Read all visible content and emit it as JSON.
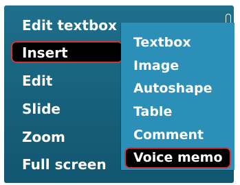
{
  "main_menu": {
    "items": [
      {
        "label": "Edit textbox"
      },
      {
        "label": "Insert"
      },
      {
        "label": "Edit"
      },
      {
        "label": "Slide"
      },
      {
        "label": "Zoom"
      },
      {
        "label": "Full screen"
      }
    ],
    "selected_item": "Insert"
  },
  "submenu": {
    "items": [
      {
        "label": "Textbox"
      },
      {
        "label": "Image"
      },
      {
        "label": "Autoshape"
      },
      {
        "label": "Table"
      },
      {
        "label": "Comment"
      },
      {
        "label": "Voice memo"
      }
    ],
    "selected_item": "Voice memo"
  },
  "colors": {
    "main_menu_bg": "#17607b",
    "submenu_bg": "#2c8fb7",
    "highlight_bg": "#000000",
    "highlight_border": "#d43335",
    "text": "#ffffff"
  },
  "icons": {
    "scroll_indicator": "scroll-indicator-icon"
  }
}
